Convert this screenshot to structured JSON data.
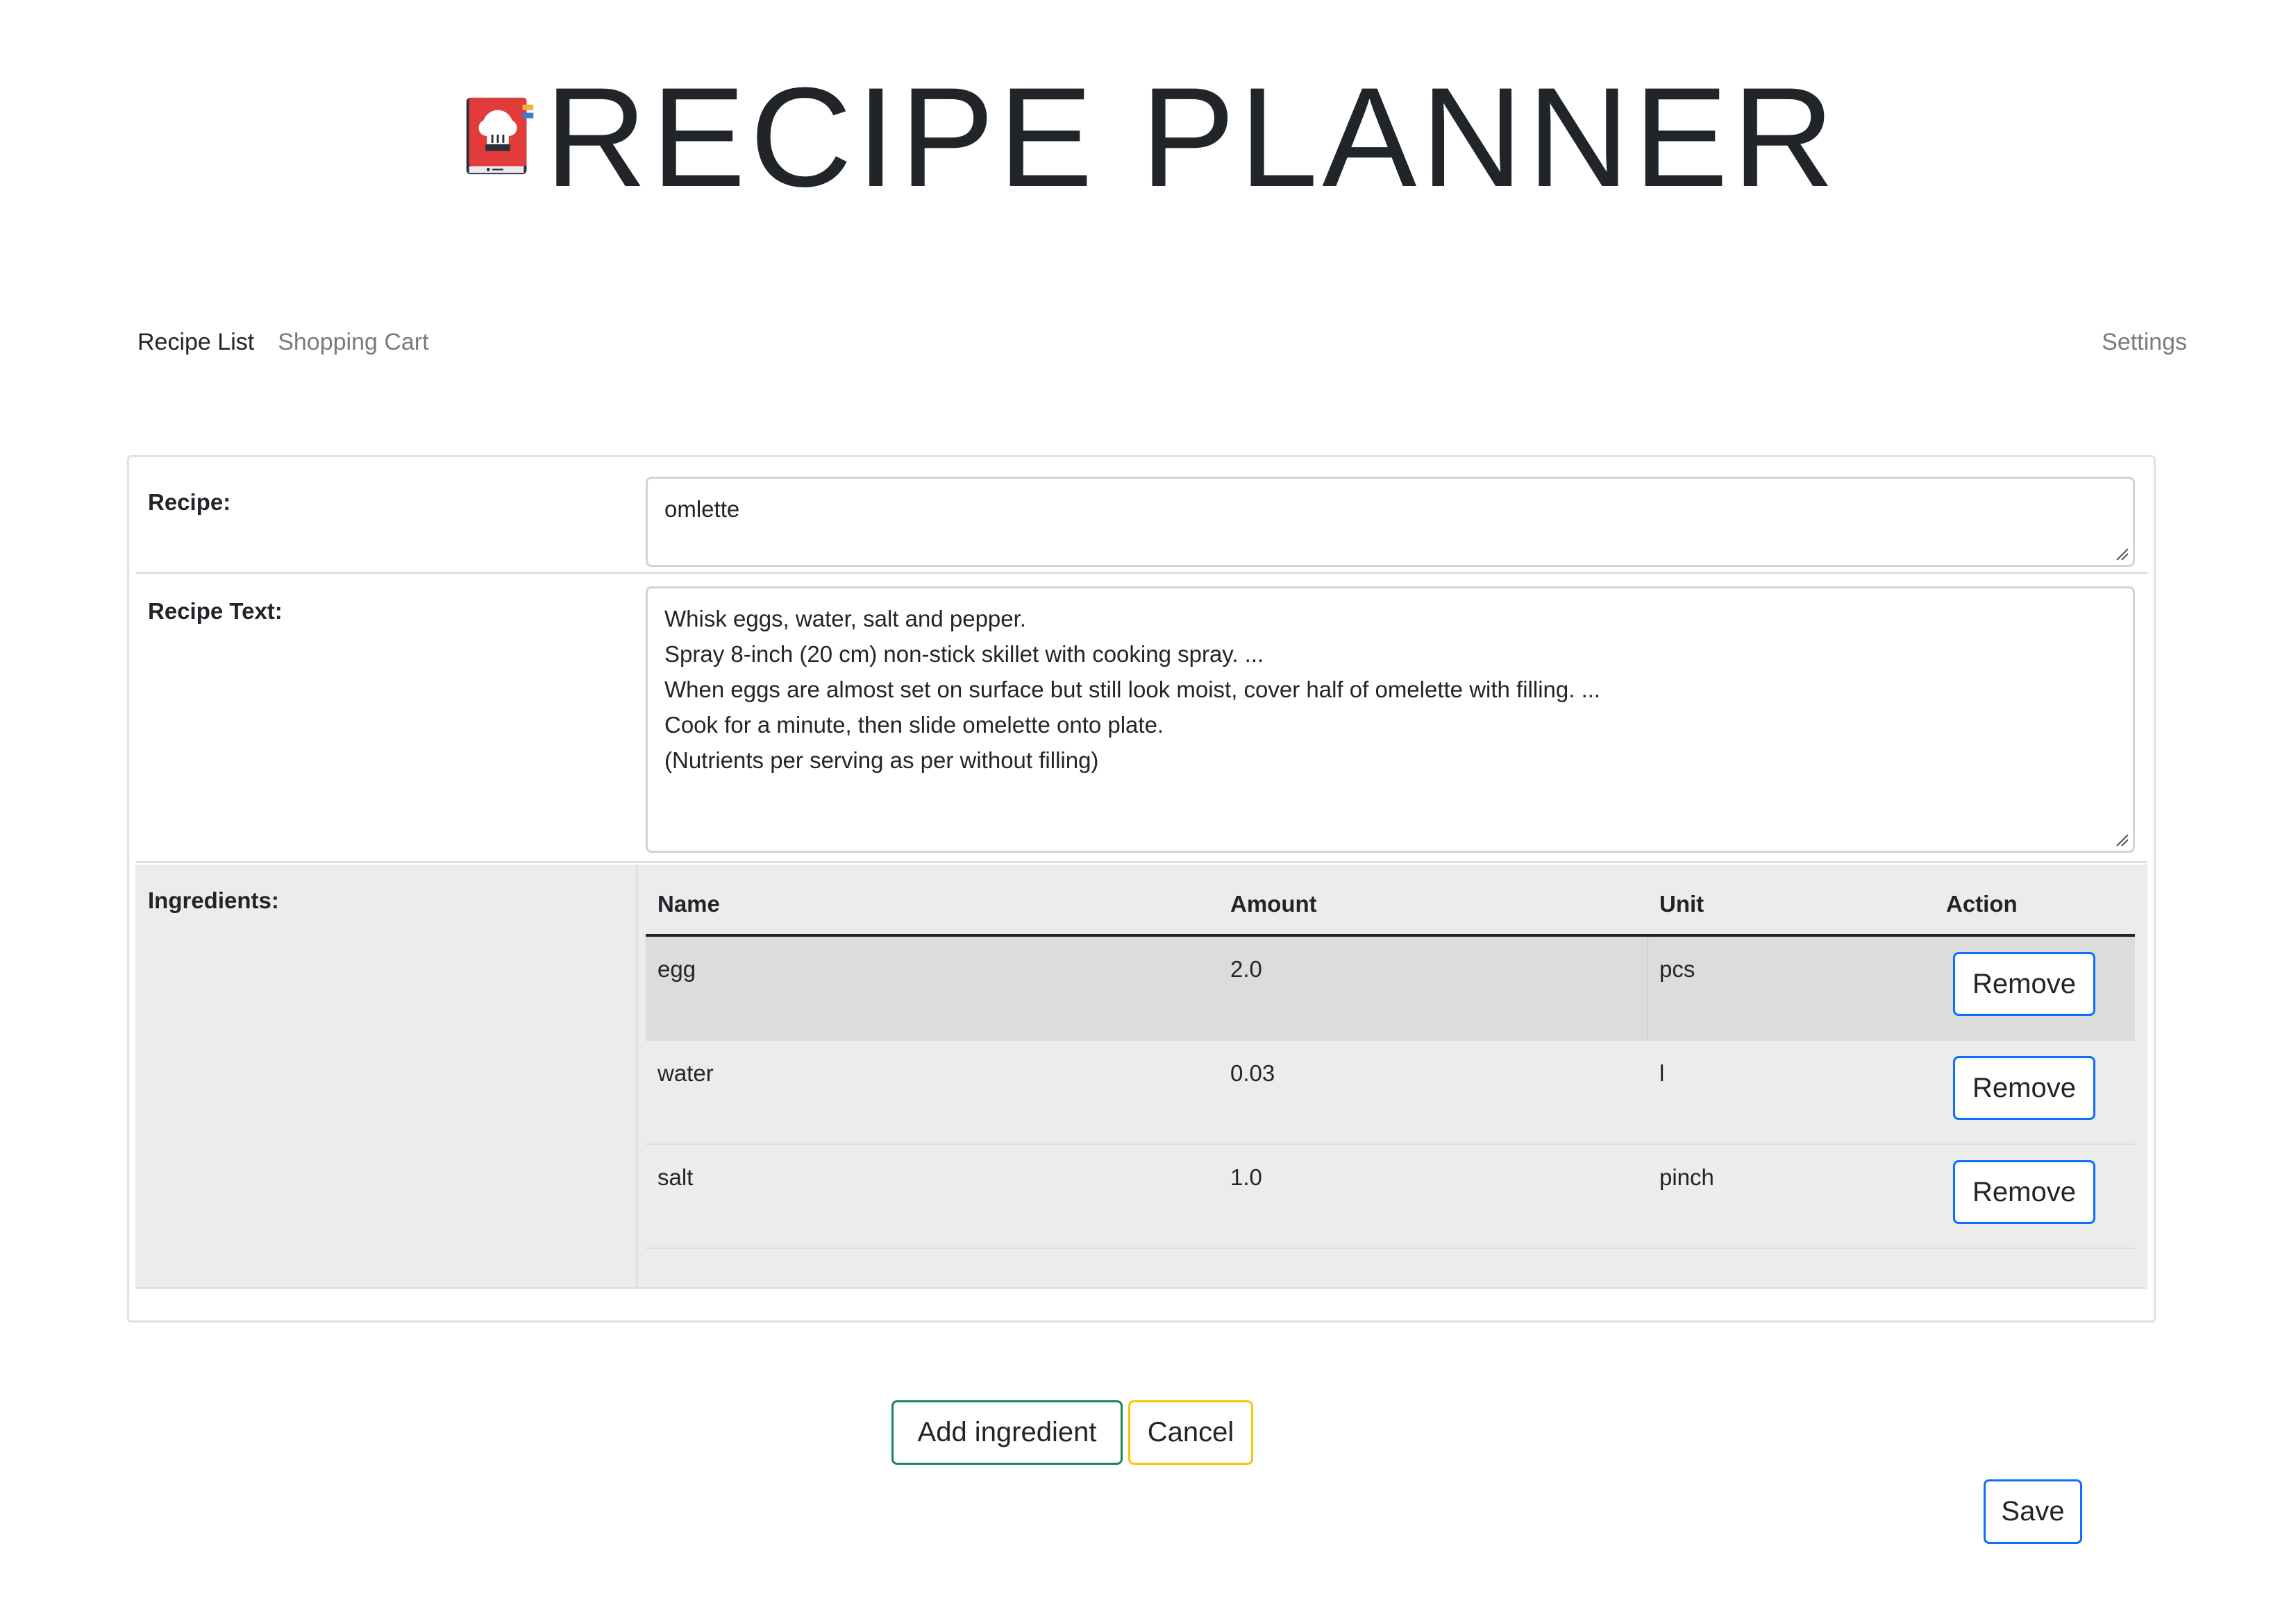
{
  "header": {
    "title": "RECIPE PLANNER",
    "logo_icon": "recipe-book-icon",
    "colors": {
      "book_red": "#e23b3b",
      "book_dark": "#2f2f3a",
      "bookmark_blue": "#3a7bd5",
      "bookmark_gold": "#f2b233"
    }
  },
  "nav": {
    "items": [
      {
        "label": "Recipe List",
        "active": true
      },
      {
        "label": "Shopping Cart",
        "active": false
      }
    ],
    "settings_label": "Settings"
  },
  "form": {
    "recipe_label": "Recipe:",
    "recipe_value": "omlette",
    "recipe_text_label": "Recipe Text:",
    "recipe_text_value": "Whisk eggs, water, salt and pepper.\nSpray 8-inch (20 cm) non-stick skillet with cooking spray. ...\nWhen eggs are almost set on surface but still look moist, cover half of omelette with filling. ...\nCook for a minute, then slide omelette onto plate.\n(Nutrients per serving as per without filling)",
    "ingredients_label": "Ingredients:"
  },
  "ingredients": {
    "columns": [
      "Name",
      "Amount",
      "Unit",
      "Action"
    ],
    "rows": [
      {
        "name": "egg",
        "amount": "2.0",
        "unit": "pcs",
        "action_label": "Remove"
      },
      {
        "name": "water",
        "amount": "0.03",
        "unit": "l",
        "action_label": "Remove"
      },
      {
        "name": "salt",
        "amount": "1.0",
        "unit": "pinch",
        "action_label": "Remove"
      }
    ]
  },
  "actions": {
    "add_label": "Add ingredient",
    "cancel_label": "Cancel",
    "save_label": "Save"
  },
  "colors": {
    "primary_outline": "#0d6efd",
    "success_outline": "#198754",
    "warning_outline": "#ffc107",
    "ingredients_bg": "#ececec",
    "hover_row_bg": "#dcdcdc"
  }
}
